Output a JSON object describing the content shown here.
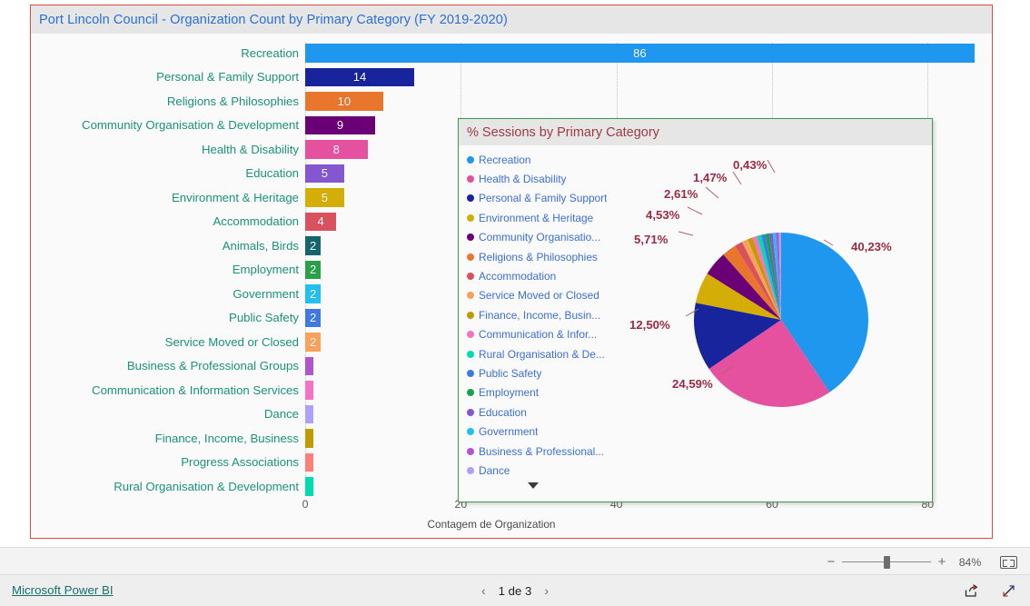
{
  "report": {
    "bar_visual": {
      "title": "Port Lincoln Council - Organization Count by Primary Category (FY 2019-2020)",
      "x_axis_title": "Contagem de Organization",
      "x_ticks": [
        "0",
        "20",
        "40",
        "60",
        "80"
      ]
    },
    "pie_visual": {
      "title": "% Sessions by Primary Category",
      "scroll_chevron": "chevron-down-icon"
    }
  },
  "toolbar": {
    "zoom_minus": "−",
    "zoom_plus": "+",
    "zoom_percent": "84%",
    "fit_icon": "fit-to-page-icon"
  },
  "footer": {
    "brand_link": "Microsoft Power BI",
    "prev_arrow": "‹",
    "next_arrow": "›",
    "page_label": "1 de 3",
    "share_icon": "share-icon",
    "fullscreen_icon": "fullscreen-icon"
  },
  "chart_data": [
    {
      "type": "bar",
      "title": "Port Lincoln Council - Organization Count by Primary Category (FY 2019-2020)",
      "orientation": "horizontal",
      "xlabel": "Contagem de Organization",
      "ylabel": "",
      "xlim": [
        0,
        86.5
      ],
      "x_ticks": [
        0,
        20,
        40,
        60,
        80
      ],
      "grid": true,
      "categories": [
        "Recreation",
        "Personal & Family Support",
        "Religions & Philosophies",
        "Community Organisation & Development",
        "Health & Disability",
        "Education",
        "Environment & Heritage",
        "Accommodation",
        "Animals, Birds",
        "Employment",
        "Government",
        "Public Safety",
        "Service Moved or Closed",
        "Business & Professional Groups",
        "Communication & Information Services",
        "Dance",
        "Finance, Income, Business",
        "Progress Associations",
        "Rural Organisation & Development"
      ],
      "values": [
        86,
        14,
        10,
        9,
        8,
        5,
        5,
        4,
        2,
        2,
        2,
        2,
        2,
        1,
        1,
        1,
        1,
        1,
        1
      ],
      "value_labels": [
        "86",
        "14",
        "10",
        "9",
        "8",
        "5",
        "5",
        "4",
        "2",
        "2",
        "2",
        "2",
        "2",
        "",
        "",
        "",
        "",
        "",
        ""
      ],
      "colors": [
        "#1f97ef",
        "#18249b",
        "#e8762c",
        "#6b0076",
        "#e5519f",
        "#8457d1",
        "#d4ad07",
        "#d9515c",
        "#15656e",
        "#2aa147",
        "#21c0f0",
        "#3e7ae0",
        "#f8a25b",
        "#b154cd",
        "#f573c4",
        "#aea0fb",
        "#c39a04",
        "#fb8078",
        "#00dcb0"
      ]
    },
    {
      "type": "pie",
      "title": "% Sessions by Primary Category",
      "legend_position": "left",
      "labels": [
        "Recreation",
        "Health & Disability",
        "Personal & Family Support",
        "Environment & Heritage",
        "Community Organisatio...",
        "Religions & Philosophies",
        "Accommodation",
        "Service Moved or Closed",
        "Finance, Income, Busin...",
        "Communication & Infor...",
        "Rural Organisation & De...",
        "Public Safety",
        "Employment",
        "Education",
        "Government",
        "Business & Professional...",
        "Dance"
      ],
      "values": [
        40.23,
        24.59,
        12.5,
        5.71,
        4.53,
        2.61,
        1.47,
        1.1,
        0.95,
        0.85,
        0.8,
        0.75,
        0.7,
        0.65,
        0.6,
        0.5,
        0.43
      ],
      "displayed_labels": [
        "40,23%",
        "24,59%",
        "12,50%",
        "5,71%",
        "4,53%",
        "2,61%",
        "1,47%",
        "0,43%"
      ],
      "colors": [
        "#1f97ef",
        "#e5519f",
        "#18249b",
        "#d4ad07",
        "#6b0076",
        "#e8762c",
        "#d9515c",
        "#f8a25b",
        "#c39a04",
        "#f573c4",
        "#00dcb0",
        "#3e7ae0",
        "#17a349",
        "#8457d1",
        "#21c0f0",
        "#b154cd",
        "#aea0fb"
      ]
    }
  ]
}
